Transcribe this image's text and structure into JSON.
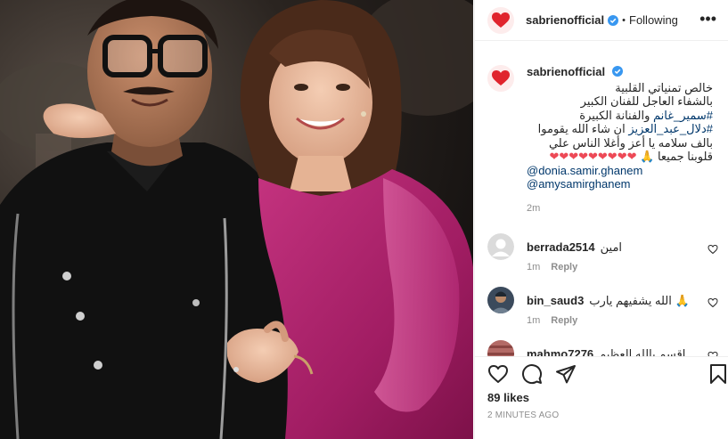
{
  "post": {
    "username": "sabrienofficial",
    "follow_separator": "•",
    "follow_state": "Following",
    "more_glyph": "•••",
    "caption_lines": [
      "خالص تمنياتي القلبية",
      "بالشفاء العاجل للفنان الكبير",
      "#سمير_غانم",
      "والفنانة الكبيرة",
      "#دلال_عبد_العزيز",
      "ان شاء",
      "الله يقوموا بالف سلامه يا أعز وأغلا الناس",
      "علي قلوبنا جميعا",
      "🙏",
      "❤❤❤❤❤❤❤❤❤"
    ],
    "mentions": [
      "@donia.samir.ghanem",
      "@amysamirghanem"
    ],
    "caption_time": "2m",
    "likes": "89 likes",
    "time_ago": "2 MINUTES AGO"
  },
  "comments": [
    {
      "username": "berrada2514",
      "text": "امين",
      "time": "1m",
      "reply_label": "Reply",
      "avatar": "default"
    },
    {
      "username": "bin_saud3",
      "text": "الله يشفيهم يارب 🙏",
      "time": "1m",
      "reply_label": "Reply",
      "avatar": "photo"
    },
    {
      "username": "mahmo7276",
      "text": "اقسم بالله العظيم",
      "time": "",
      "reply_label": "",
      "avatar": "photo2"
    }
  ],
  "icons": {
    "verified": "verified-badge-icon",
    "more": "more-options-icon",
    "like": "heart-icon",
    "comment": "comment-bubble-icon",
    "share": "paper-plane-icon",
    "save": "bookmark-icon",
    "comment_like": "small-heart-icon"
  },
  "colors": {
    "link": "#00376b",
    "verified": "#3897f0",
    "muted": "#8e8e8e",
    "heart_red": "#ed4956",
    "dress_magenta": "#b0226e"
  }
}
